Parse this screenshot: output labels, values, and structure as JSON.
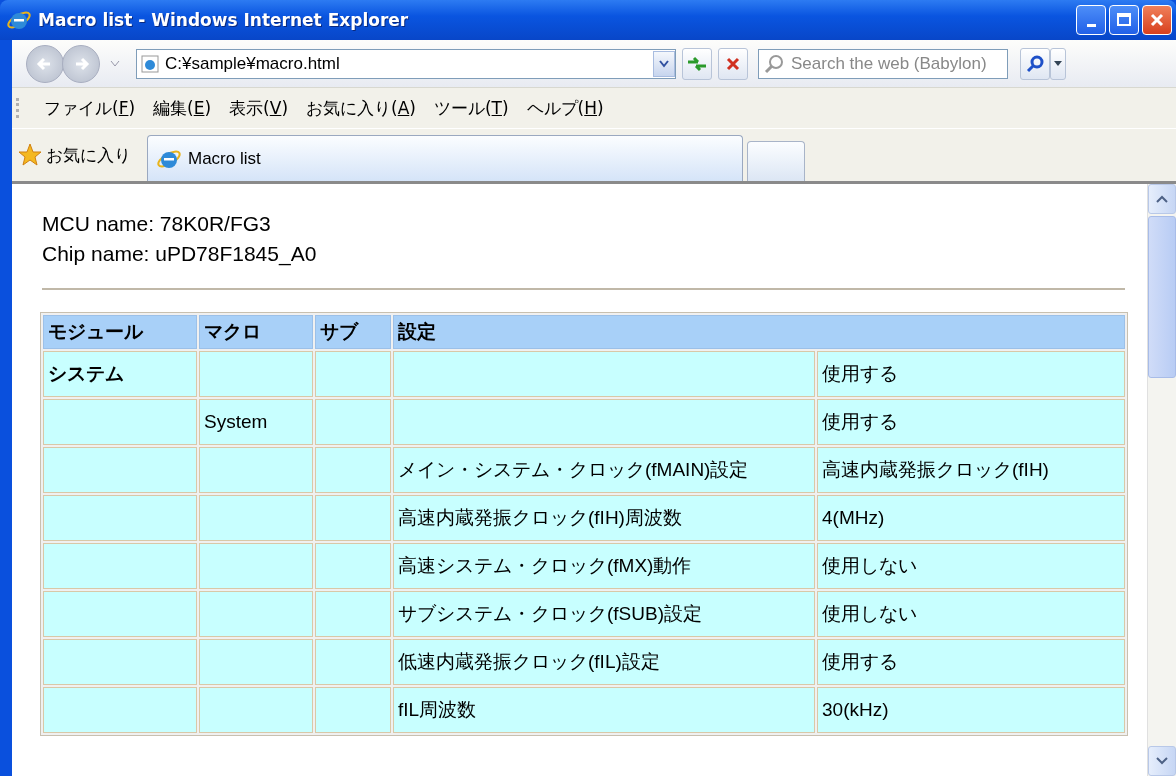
{
  "window": {
    "title": "Macro list - Windows Internet Explorer"
  },
  "address_bar": {
    "value": "C:¥sample¥macro.html"
  },
  "search": {
    "placeholder": "Search the web (Babylon)"
  },
  "menu": [
    "ファイル(F)",
    "編集(E)",
    "表示(V)",
    "お気に入り(A)",
    "ツール(T)",
    "ヘルプ(H)"
  ],
  "favorites_bar": {
    "label": "お気に入り"
  },
  "tabs": [
    {
      "label": "Macro list",
      "selected": true
    }
  ],
  "page": {
    "lines": [
      "MCU name: 78K0R/FG3",
      "Chip name: uPD78F1845_A0"
    ],
    "table": {
      "columns": [
        "モジュール",
        "マクロ",
        "サブ",
        "設定"
      ],
      "rows": [
        {
          "module": "システム",
          "value": "使用する"
        },
        {
          "macro": "System",
          "value": "使用する"
        },
        {
          "setting": "メイン・システム・クロック(fMAIN)設定",
          "value": "高速内蔵発振クロック(fIH)"
        },
        {
          "setting": "高速内蔵発振クロック(fIH)周波数",
          "value": "4(MHz)"
        },
        {
          "setting": "高速システム・クロック(fMX)動作",
          "value": "使用しない"
        },
        {
          "setting": "サブシステム・クロック(fSUB)設定",
          "value": "使用しない"
        },
        {
          "setting": "低速内蔵発振クロック(fIL)設定",
          "value": "使用する"
        },
        {
          "setting": "fIL周波数",
          "value": "30(kHz)"
        }
      ]
    }
  }
}
